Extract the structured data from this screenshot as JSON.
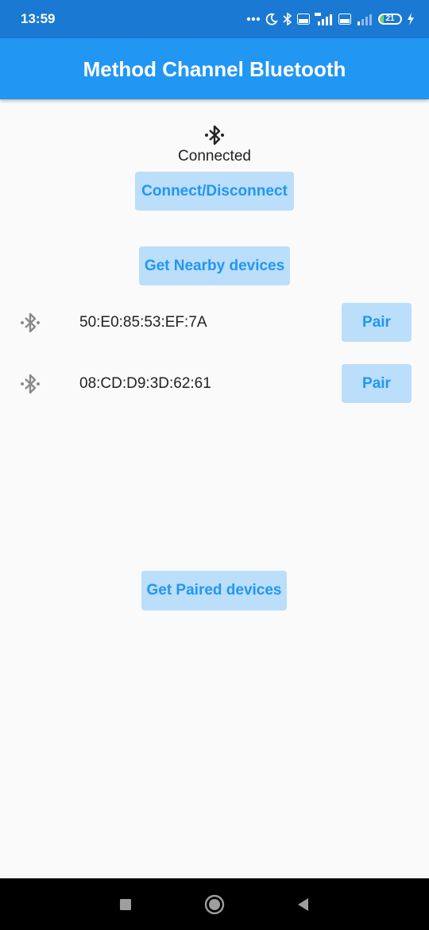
{
  "status_bar": {
    "time": "13:59",
    "battery_level": "21",
    "icons": [
      "more-dots-icon",
      "moon-icon",
      "bluetooth-icon",
      "volte-icon",
      "signal-4g-icon",
      "volte-icon",
      "signal-icon",
      "battery-icon",
      "charging-icon"
    ]
  },
  "app_bar": {
    "title": "Method Channel Bluetooth"
  },
  "main": {
    "bluetooth_icon": "bluetooth-connected-icon",
    "status_text": "Connected",
    "connect_button_label": "Connect/Disconnect",
    "nearby_button_label": "Get Nearby devices",
    "devices": [
      {
        "address": "50:E0:85:53:EF:7A",
        "pair_label": "Pair",
        "icon": "bluetooth-searching-icon"
      },
      {
        "address": "08:CD:D9:3D:62:61",
        "pair_label": "Pair",
        "icon": "bluetooth-searching-icon"
      }
    ],
    "paired_button_label": "Get Paired devices"
  },
  "nav_bar": {
    "icons": [
      "recent-apps-icon",
      "home-icon",
      "back-icon"
    ]
  },
  "colors": {
    "status_bar": "#1a79d2",
    "app_bar": "#2196f3",
    "button_bg": "#bbdefb",
    "button_text": "#2196f3",
    "background": "#fafafa"
  }
}
